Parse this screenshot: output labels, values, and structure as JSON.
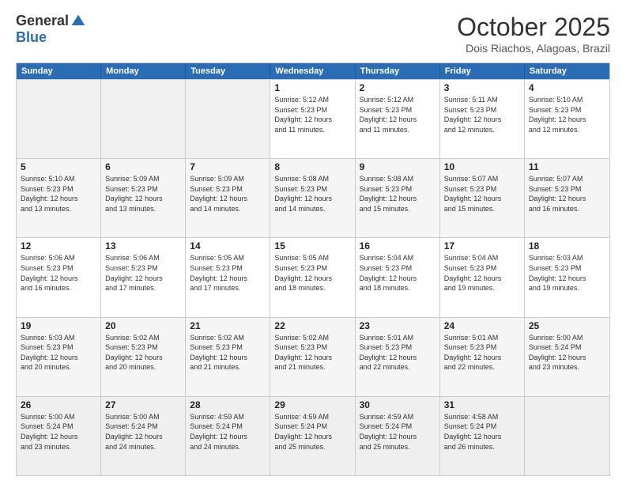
{
  "logo": {
    "general": "General",
    "blue": "Blue"
  },
  "header": {
    "month": "October 2025",
    "location": "Dois Riachos, Alagoas, Brazil"
  },
  "weekdays": [
    "Sunday",
    "Monday",
    "Tuesday",
    "Wednesday",
    "Thursday",
    "Friday",
    "Saturday"
  ],
  "rows": [
    [
      {
        "day": "",
        "info": ""
      },
      {
        "day": "",
        "info": ""
      },
      {
        "day": "",
        "info": ""
      },
      {
        "day": "1",
        "info": "Sunrise: 5:12 AM\nSunset: 5:23 PM\nDaylight: 12 hours\nand 11 minutes."
      },
      {
        "day": "2",
        "info": "Sunrise: 5:12 AM\nSunset: 5:23 PM\nDaylight: 12 hours\nand 11 minutes."
      },
      {
        "day": "3",
        "info": "Sunrise: 5:11 AM\nSunset: 5:23 PM\nDaylight: 12 hours\nand 12 minutes."
      },
      {
        "day": "4",
        "info": "Sunrise: 5:10 AM\nSunset: 5:23 PM\nDaylight: 12 hours\nand 12 minutes."
      }
    ],
    [
      {
        "day": "5",
        "info": "Sunrise: 5:10 AM\nSunset: 5:23 PM\nDaylight: 12 hours\nand 13 minutes."
      },
      {
        "day": "6",
        "info": "Sunrise: 5:09 AM\nSunset: 5:23 PM\nDaylight: 12 hours\nand 13 minutes."
      },
      {
        "day": "7",
        "info": "Sunrise: 5:09 AM\nSunset: 5:23 PM\nDaylight: 12 hours\nand 14 minutes."
      },
      {
        "day": "8",
        "info": "Sunrise: 5:08 AM\nSunset: 5:23 PM\nDaylight: 12 hours\nand 14 minutes."
      },
      {
        "day": "9",
        "info": "Sunrise: 5:08 AM\nSunset: 5:23 PM\nDaylight: 12 hours\nand 15 minutes."
      },
      {
        "day": "10",
        "info": "Sunrise: 5:07 AM\nSunset: 5:23 PM\nDaylight: 12 hours\nand 15 minutes."
      },
      {
        "day": "11",
        "info": "Sunrise: 5:07 AM\nSunset: 5:23 PM\nDaylight: 12 hours\nand 16 minutes."
      }
    ],
    [
      {
        "day": "12",
        "info": "Sunrise: 5:06 AM\nSunset: 5:23 PM\nDaylight: 12 hours\nand 16 minutes."
      },
      {
        "day": "13",
        "info": "Sunrise: 5:06 AM\nSunset: 5:23 PM\nDaylight: 12 hours\nand 17 minutes."
      },
      {
        "day": "14",
        "info": "Sunrise: 5:05 AM\nSunset: 5:23 PM\nDaylight: 12 hours\nand 17 minutes."
      },
      {
        "day": "15",
        "info": "Sunrise: 5:05 AM\nSunset: 5:23 PM\nDaylight: 12 hours\nand 18 minutes."
      },
      {
        "day": "16",
        "info": "Sunrise: 5:04 AM\nSunset: 5:23 PM\nDaylight: 12 hours\nand 18 minutes."
      },
      {
        "day": "17",
        "info": "Sunrise: 5:04 AM\nSunset: 5:23 PM\nDaylight: 12 hours\nand 19 minutes."
      },
      {
        "day": "18",
        "info": "Sunrise: 5:03 AM\nSunset: 5:23 PM\nDaylight: 12 hours\nand 19 minutes."
      }
    ],
    [
      {
        "day": "19",
        "info": "Sunrise: 5:03 AM\nSunset: 5:23 PM\nDaylight: 12 hours\nand 20 minutes."
      },
      {
        "day": "20",
        "info": "Sunrise: 5:02 AM\nSunset: 5:23 PM\nDaylight: 12 hours\nand 20 minutes."
      },
      {
        "day": "21",
        "info": "Sunrise: 5:02 AM\nSunset: 5:23 PM\nDaylight: 12 hours\nand 21 minutes."
      },
      {
        "day": "22",
        "info": "Sunrise: 5:02 AM\nSunset: 5:23 PM\nDaylight: 12 hours\nand 21 minutes."
      },
      {
        "day": "23",
        "info": "Sunrise: 5:01 AM\nSunset: 5:23 PM\nDaylight: 12 hours\nand 22 minutes."
      },
      {
        "day": "24",
        "info": "Sunrise: 5:01 AM\nSunset: 5:23 PM\nDaylight: 12 hours\nand 22 minutes."
      },
      {
        "day": "25",
        "info": "Sunrise: 5:00 AM\nSunset: 5:24 PM\nDaylight: 12 hours\nand 23 minutes."
      }
    ],
    [
      {
        "day": "26",
        "info": "Sunrise: 5:00 AM\nSunset: 5:24 PM\nDaylight: 12 hours\nand 23 minutes."
      },
      {
        "day": "27",
        "info": "Sunrise: 5:00 AM\nSunset: 5:24 PM\nDaylight: 12 hours\nand 24 minutes."
      },
      {
        "day": "28",
        "info": "Sunrise: 4:59 AM\nSunset: 5:24 PM\nDaylight: 12 hours\nand 24 minutes."
      },
      {
        "day": "29",
        "info": "Sunrise: 4:59 AM\nSunset: 5:24 PM\nDaylight: 12 hours\nand 25 minutes."
      },
      {
        "day": "30",
        "info": "Sunrise: 4:59 AM\nSunset: 5:24 PM\nDaylight: 12 hours\nand 25 minutes."
      },
      {
        "day": "31",
        "info": "Sunrise: 4:58 AM\nSunset: 5:24 PM\nDaylight: 12 hours\nand 26 minutes."
      },
      {
        "day": "",
        "info": ""
      }
    ]
  ]
}
